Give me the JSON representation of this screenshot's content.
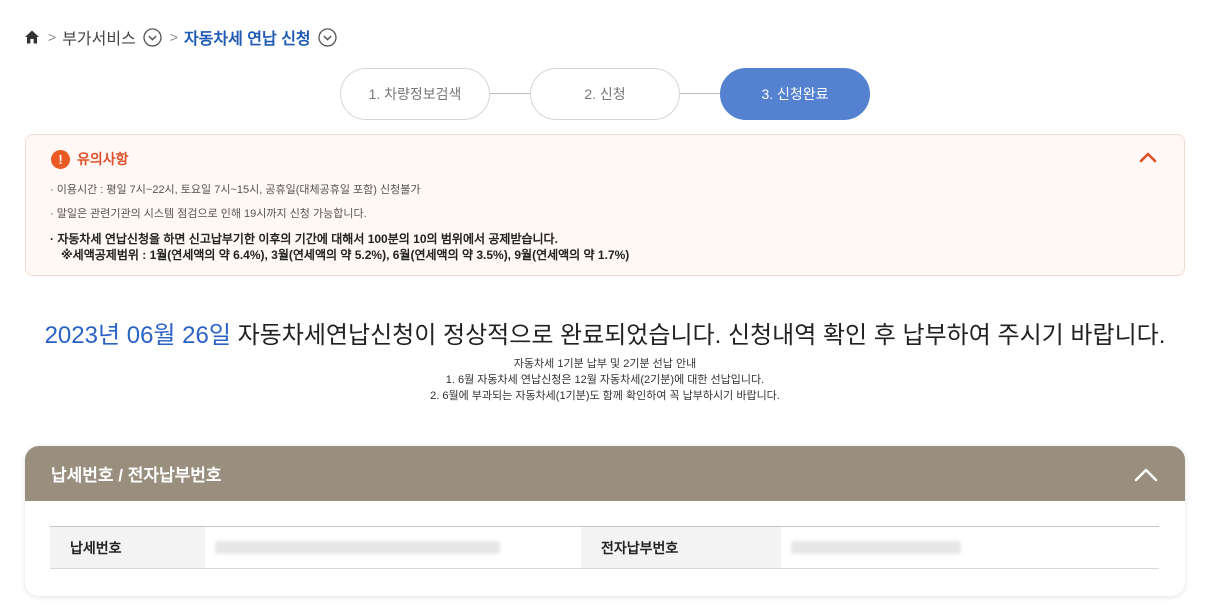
{
  "breadcrumb": {
    "home_icon": "home-icon",
    "items": [
      {
        "label": "부가서비스",
        "has_dropdown": true
      },
      {
        "label": "자동차세 연납 신청",
        "has_dropdown": true,
        "current": true
      }
    ]
  },
  "steps": [
    {
      "label": "1. 차량정보검색",
      "active": false
    },
    {
      "label": "2. 신청",
      "active": false
    },
    {
      "label": "3. 신청완료",
      "active": true
    }
  ],
  "notice": {
    "title": "유의사항",
    "icon": "exclamation-icon",
    "toggle_icon": "chevron-up-icon",
    "items": [
      "· 이용시간 : 평일 7시~22시, 토요일 7시~15시, 공휴일(대체공휴일 포함) 신청불가",
      "· 말일은 관련기관의 시스템 점검으로 인해 19시까지 신청 가능합니다.",
      "· 자동차세 연납신청을 하면 신고납부기한 이후의 기간에 대해서 100분의 10의 범위에서 공제받습니다."
    ],
    "deduction_range": "※세액공제범위 : 1월(연세액의 약 6.4%), 3월(연세액의 약 5.2%), 6월(연세액의 약 3.5%), 9월(연세액의 약 1.7%)"
  },
  "complete": {
    "date": "2023년 06월 26일",
    "message": " 자동차세연납신청이 정상적으로 완료되었습니다. 신청내역 확인 후 납부하여 주시기 바랍니다.",
    "details": [
      "자동차세 1기분 납부 및 2기분 선납 안내",
      "1. 6월 자동차세 연납신청은 12월 자동차세(2기분)에 대한 선납입니다.",
      "2. 6월에 부과되는 자동차세(1기분)도 함께 확인하여 꼭 납부하시기 바랍니다."
    ]
  },
  "panel": {
    "title": "납세번호 / 전자납부번호",
    "toggle_icon": "chevron-up-icon",
    "tax_number_label": "납세번호",
    "tax_number_value": "",
    "epay_number_label": "전자납부번호",
    "epay_number_value": ""
  },
  "colors": {
    "accent_blue": "#2a62c6",
    "step_active": "#5582d0",
    "notice_orange": "#ea5a24",
    "panel_head": "#9a8f7e"
  }
}
